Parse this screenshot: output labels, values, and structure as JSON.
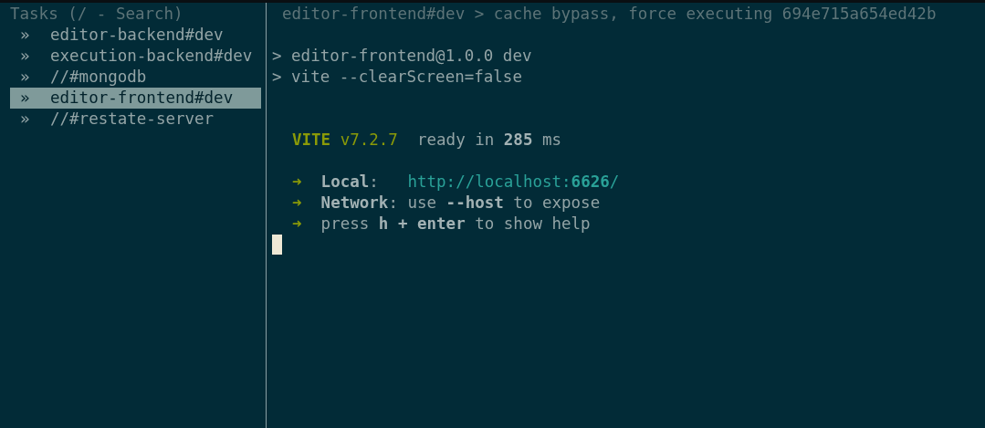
{
  "sidebar": {
    "title": "Tasks (/ - Search)",
    "tasks": [
      {
        "marker": "»",
        "label": "editor-backend#dev",
        "selected": false
      },
      {
        "marker": "»",
        "label": "execution-backend#dev",
        "selected": false
      },
      {
        "marker": "»",
        "label": "//#mongodb",
        "selected": false
      },
      {
        "marker": "»",
        "label": "editor-frontend#dev",
        "selected": true
      },
      {
        "marker": "»",
        "label": "//#restate-server",
        "selected": false
      }
    ]
  },
  "output": {
    "header": "editor-frontend#dev > cache bypass, force executing 694e715a654ed42b",
    "lines": [
      {
        "kind": "blank"
      },
      {
        "kind": "command",
        "segments": [
          {
            "text": "> editor-frontend@1.0.0 dev",
            "kind": "plain"
          }
        ]
      },
      {
        "kind": "command",
        "segments": [
          {
            "text": "> vite --clearScreen=false",
            "kind": "plain"
          }
        ]
      },
      {
        "kind": "blank"
      },
      {
        "kind": "blank"
      },
      {
        "kind": "info",
        "segments": [
          {
            "text": "VITE",
            "kind": "accent-bold"
          },
          {
            "text": " v7.2.7",
            "kind": "accent"
          },
          {
            "text": "  ready in ",
            "kind": "plain"
          },
          {
            "text": "285",
            "kind": "bold"
          },
          {
            "text": " ms",
            "kind": "plain"
          }
        ]
      },
      {
        "kind": "blank"
      },
      {
        "kind": "info",
        "segments": [
          {
            "text": "➜",
            "kind": "accent"
          },
          {
            "text": "  Local",
            "kind": "bold"
          },
          {
            "text": ":   ",
            "kind": "plain"
          },
          {
            "text": "http://localhost:",
            "kind": "link"
          },
          {
            "text": "6626",
            "kind": "link-bold"
          },
          {
            "text": "/",
            "kind": "link"
          }
        ]
      },
      {
        "kind": "info",
        "segments": [
          {
            "text": "➜",
            "kind": "accent"
          },
          {
            "text": "  Network",
            "kind": "bold"
          },
          {
            "text": ": use ",
            "kind": "plain"
          },
          {
            "text": "--host",
            "kind": "bold"
          },
          {
            "text": " to expose",
            "kind": "plain"
          }
        ]
      },
      {
        "kind": "info",
        "segments": [
          {
            "text": "➜",
            "kind": "accent"
          },
          {
            "text": "  press ",
            "kind": "plain"
          },
          {
            "text": "h + enter",
            "kind": "bold"
          },
          {
            "text": " to show help",
            "kind": "plain"
          }
        ]
      }
    ],
    "cursor": {
      "visible": true
    }
  }
}
